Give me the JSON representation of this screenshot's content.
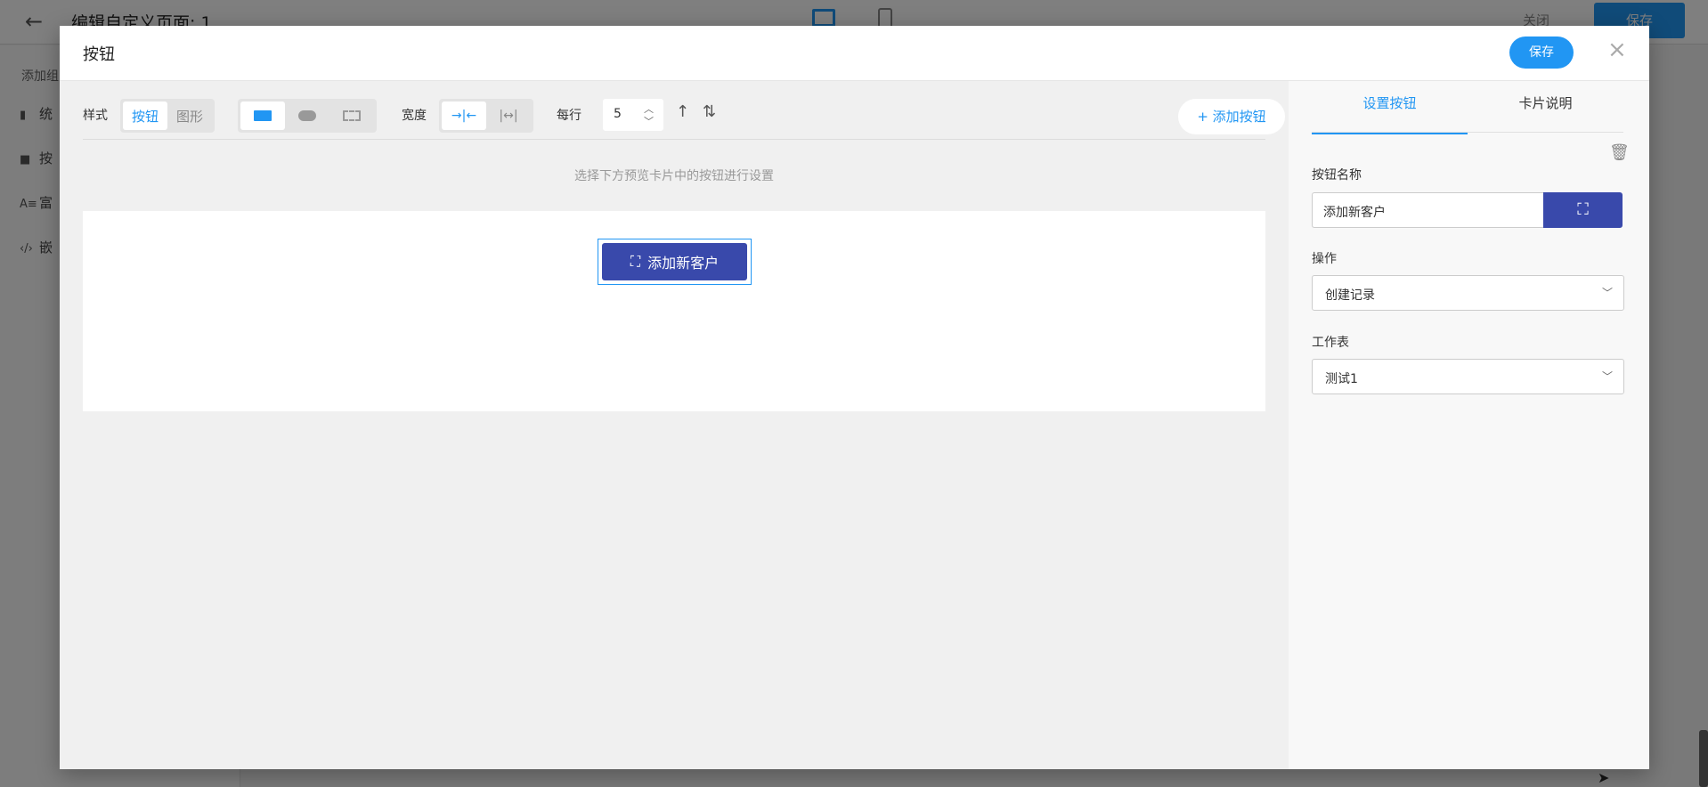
{
  "background": {
    "title": "编辑自定义页面: 1",
    "close_label": "关闭",
    "save_label": "保存",
    "sidebar_title": "添加组",
    "sidebar_items": [
      {
        "icon": "chart-icon",
        "label": "统"
      },
      {
        "icon": "button-icon",
        "label": "按"
      },
      {
        "icon": "richtext-icon",
        "label": "富"
      },
      {
        "icon": "code-icon",
        "label": "嵌"
      }
    ]
  },
  "modal": {
    "title": "按钮",
    "save_label": "保存",
    "close_glyph": "×"
  },
  "toolbar": {
    "style_label": "样式",
    "style_options": [
      "按钮",
      "图形"
    ],
    "width_label": "宽度",
    "per_row_label": "每行",
    "per_row_value": "5",
    "add_button_label": "+ 添加按钮"
  },
  "editor": {
    "hint": "选择下方预览卡片中的按钮进行设置",
    "preview_button_label": "添加新客户",
    "preview_button_color": "#3949ab"
  },
  "settings": {
    "tabs": [
      "设置按钮",
      "卡片说明"
    ],
    "name_label": "按钮名称",
    "name_value": "添加新客户",
    "action_label": "操作",
    "action_value": "创建记录",
    "sheet_label": "工作表",
    "sheet_value": "测试1"
  },
  "colors": {
    "accent": "#2196f3",
    "button": "#3949ab"
  }
}
